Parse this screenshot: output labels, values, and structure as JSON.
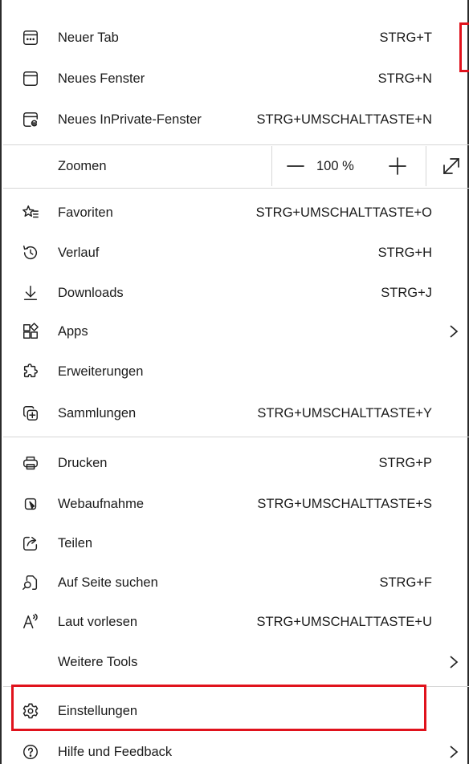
{
  "menu": {
    "neuer_tab": {
      "label": "Neuer Tab",
      "shortcut": "STRG+T"
    },
    "neues_fenster": {
      "label": "Neues Fenster",
      "shortcut": "STRG+N"
    },
    "inprivate": {
      "label": "Neues InPrivate-Fenster",
      "shortcut": "STRG+UMSCHALTTASTE+N"
    },
    "zoom": {
      "label": "Zoomen",
      "value": "100 %"
    },
    "favoriten": {
      "label": "Favoriten",
      "shortcut": "STRG+UMSCHALTTASTE+O"
    },
    "verlauf": {
      "label": "Verlauf",
      "shortcut": "STRG+H"
    },
    "downloads": {
      "label": "Downloads",
      "shortcut": "STRG+J"
    },
    "apps": {
      "label": "Apps"
    },
    "erweiterungen": {
      "label": "Erweiterungen"
    },
    "sammlungen": {
      "label": "Sammlungen",
      "shortcut": "STRG+UMSCHALTTASTE+Y"
    },
    "drucken": {
      "label": "Drucken",
      "shortcut": "STRG+P"
    },
    "webaufnahme": {
      "label": "Webaufnahme",
      "shortcut": "STRG+UMSCHALTTASTE+S"
    },
    "teilen": {
      "label": "Teilen"
    },
    "suchen": {
      "label": "Auf Seite suchen",
      "shortcut": "STRG+F"
    },
    "vorlesen": {
      "label": "Laut vorlesen",
      "shortcut": "STRG+UMSCHALTTASTE+U"
    },
    "weitere_tools": {
      "label": "Weitere Tools"
    },
    "einstellungen": {
      "label": "Einstellungen"
    },
    "hilfe": {
      "label": "Hilfe und Feedback"
    }
  },
  "colors": {
    "highlight": "#e0121c",
    "separator": "#d6d6d6",
    "text": "#1b1b1b"
  }
}
